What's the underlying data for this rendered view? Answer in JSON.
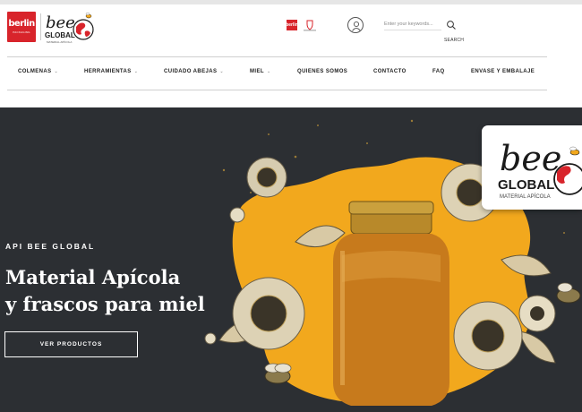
{
  "brand": {
    "berlin_text": "berlin",
    "berlin_subtext": "PACKAGING",
    "bee_text": "bee",
    "global_text": "GLOBAL",
    "material_text": "MATERIAL APÍCOLA"
  },
  "header": {
    "mini_logo_text": "berlin",
    "search_placeholder": "Enter your keywords...",
    "search_label": "SEARCH"
  },
  "nav": {
    "items": [
      {
        "label": "COLMENAS",
        "has_dropdown": true
      },
      {
        "label": "HERRAMIENTAS",
        "has_dropdown": true
      },
      {
        "label": "CUIDADO ABEJAS",
        "has_dropdown": true
      },
      {
        "label": "MIEL",
        "has_dropdown": true
      },
      {
        "label": "QUIENES SOMOS",
        "has_dropdown": false
      },
      {
        "label": "CONTACTO",
        "has_dropdown": false
      },
      {
        "label": "FAQ",
        "has_dropdown": false
      },
      {
        "label": "ENVASE Y EMBALAJE",
        "has_dropdown": false
      }
    ],
    "chevron": "⌄"
  },
  "hero": {
    "kicker": "API BEE GLOBAL",
    "title_line1": "Material Apícola",
    "title_line2": "y frascos para miel",
    "cta_label": "VER PRODUCTOS"
  },
  "icons": {
    "user": "user-icon",
    "search": "search-icon",
    "chevron": "chevron-down-icon",
    "globe": "globe-icon",
    "bee": "bee-icon"
  },
  "colors": {
    "brand_red": "#d8242b",
    "hero_bg": "#2c2f33",
    "honey": "#c77a1c",
    "splash_yellow": "#f2a81d",
    "lid_gold": "#b8892a"
  }
}
